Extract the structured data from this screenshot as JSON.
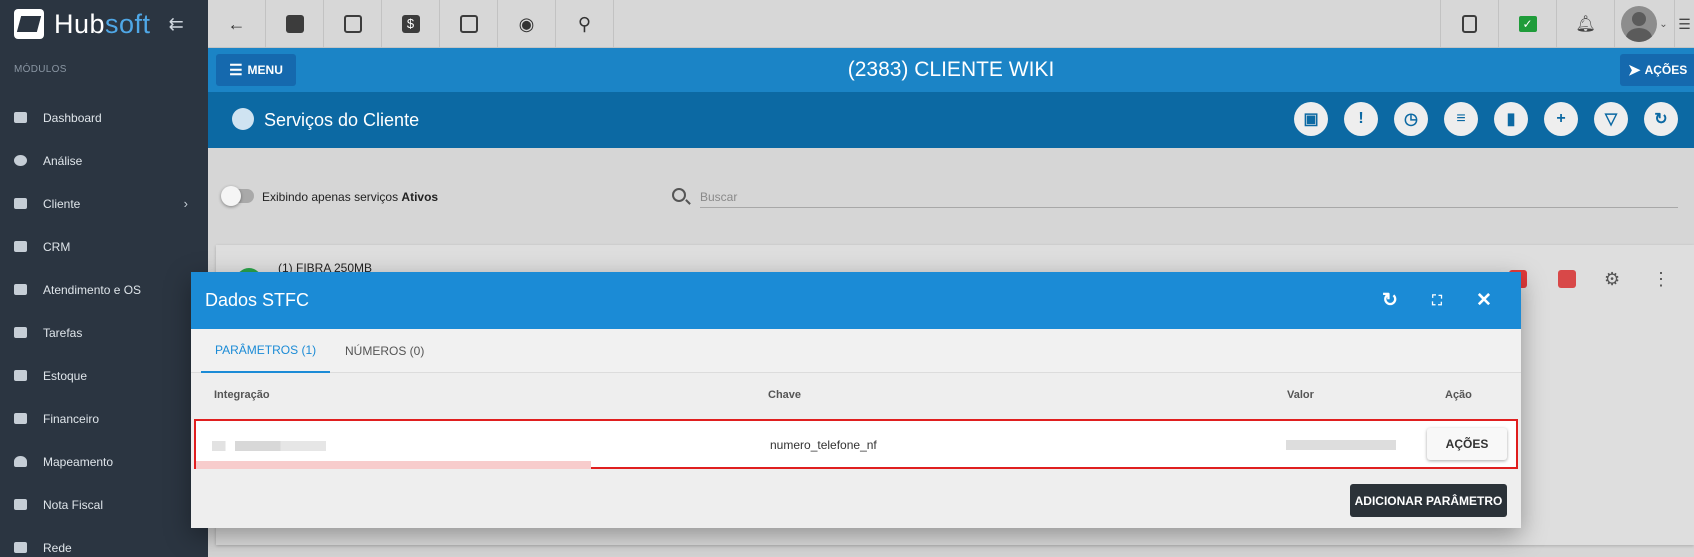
{
  "brand": {
    "word1": "Hub",
    "word2": "soft",
    "collapse_icon": "arrow-collapse-icon"
  },
  "sidebar": {
    "section_label": "MÓDULOS",
    "items": [
      {
        "label": "Dashboard",
        "icon": "dashboard-icon"
      },
      {
        "label": "Análise",
        "icon": "pie-chart-icon"
      },
      {
        "label": "Cliente",
        "icon": "contact-card-icon",
        "has_submenu": true
      },
      {
        "label": "CRM",
        "icon": "crm-board-icon"
      },
      {
        "label": "Atendimento e OS",
        "icon": "calendar-clock-icon"
      },
      {
        "label": "Tarefas",
        "icon": "briefcase-icon"
      },
      {
        "label": "Estoque",
        "icon": "box-icon"
      },
      {
        "label": "Financeiro",
        "icon": "money-icon"
      },
      {
        "label": "Mapeamento",
        "icon": "map-pin-icon"
      },
      {
        "label": "Nota Fiscal",
        "icon": "invoice-icon"
      },
      {
        "label": "Rede",
        "icon": "network-icon"
      }
    ]
  },
  "topbar": {
    "buttons": [
      "back-arrow-icon",
      "contact-card-icon",
      "calendar-clock-icon",
      "dollar-icon",
      "terminal-icon",
      "eye-icon",
      "search-icon"
    ],
    "right": [
      "pdf-icon",
      "check-badge-icon",
      "bell-icon",
      "avatar",
      "menu-list-icon"
    ]
  },
  "header": {
    "menu_label": "MENU",
    "client_title": "(2383) CLIENTE WIKI",
    "actions_label": "AÇÕES"
  },
  "services": {
    "title": "Serviços do Cliente",
    "action_icons": [
      "gift-icon",
      "alert-message-icon",
      "calendar-clock-icon",
      "list-icon",
      "document-icon",
      "plus-icon",
      "filter-icon",
      "refresh-icon"
    ]
  },
  "filter": {
    "toggle_text": "Exibindo apenas serviços ",
    "toggle_bold": "Ativos",
    "search_placeholder": "Buscar"
  },
  "service_card": {
    "name": "(1) FIBRA 250MB"
  },
  "modal": {
    "title": "Dados STFC",
    "tabs": [
      {
        "label": "PARÂMETROS (1)",
        "active": true
      },
      {
        "label": "NÚMEROS (0)",
        "active": false
      }
    ],
    "columns": {
      "integracao": "Integração",
      "chave": "Chave",
      "valor": "Valor",
      "acao": "Ação"
    },
    "rows": [
      {
        "chave": "numero_telefone_nf",
        "action_label": "AÇÕES"
      }
    ],
    "add_button": "ADICIONAR PARÂMETRO"
  },
  "colors": {
    "sidebar": "#2b3541",
    "header_blue": "#1b84c6",
    "services_blue": "#0c69a3",
    "modal_blue": "#1b8bd6",
    "highlight_red": "#e01f1f"
  }
}
